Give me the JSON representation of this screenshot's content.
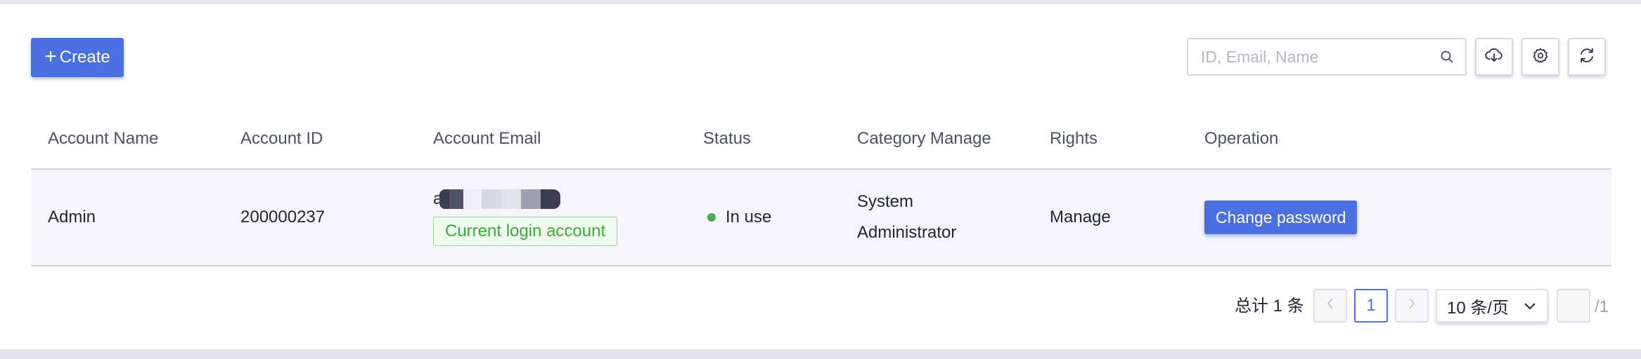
{
  "toolbar": {
    "create_icon": "plus-icon",
    "create_label": "Create",
    "search_placeholder": "ID, Email, Name",
    "search_icon": "search-icon",
    "export_icon": "cloud-download-icon",
    "settings_icon": "gear-icon",
    "refresh_icon": "refresh-icon"
  },
  "table": {
    "columns": [
      "Account Name",
      "Account ID",
      "Account Email",
      "Status",
      "Category Manage",
      "Rights",
      "Operation"
    ],
    "rows": [
      {
        "account_name": "Admin",
        "account_id": "200000237",
        "account_email_visible": "a",
        "email_badge": "Current login account",
        "status": "In use",
        "status_color": "#4caf50",
        "category_line1": "System",
        "category_line2": "Administrator",
        "rights": "Manage",
        "operation": "Change password"
      }
    ]
  },
  "pagination": {
    "total_text": "总计 1 条",
    "prev_icon": "chevron-left-icon",
    "current_page": "1",
    "next_icon": "chevron-right-icon",
    "page_size": "10 条/页",
    "page_size_icon": "chevron-down-icon",
    "jump_value": "",
    "total_pages": "/1"
  },
  "colors": {
    "primary": "#4a6fe0",
    "success": "#3ea83a",
    "row_background": "#f5f5fb"
  }
}
